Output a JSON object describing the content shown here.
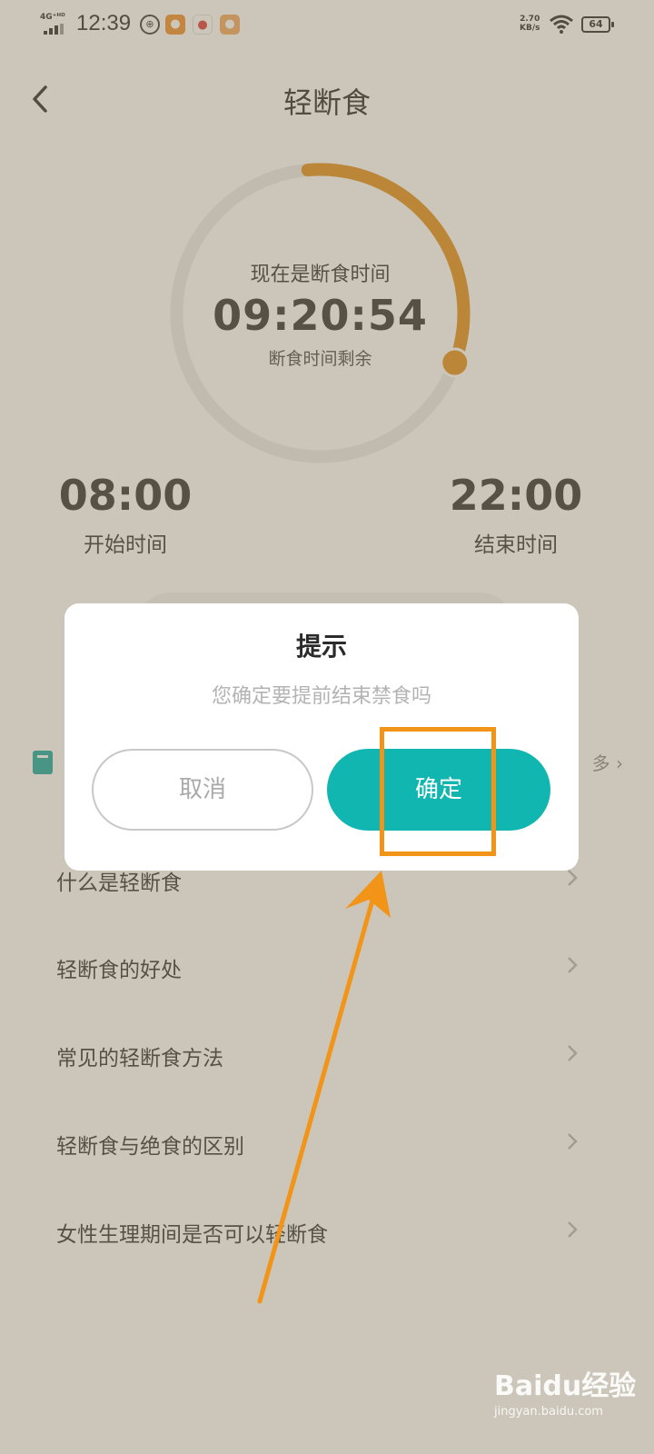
{
  "status_bar": {
    "network": "4G⁺ᴴᴰ",
    "time": "12:39",
    "speed_value": "2.70",
    "speed_unit": "KB/s",
    "battery": "64"
  },
  "header": {
    "title": "轻断食"
  },
  "timer": {
    "status": "现在是断食时间",
    "remaining": "09:20:54",
    "remaining_label": "断食时间剩余",
    "progress": 0.32
  },
  "schedule": {
    "start_time": "08:00",
    "start_label": "开始时间",
    "end_time": "22:00",
    "end_label": "结束时间"
  },
  "knowledge": {
    "more_partial": "多",
    "items": [
      {
        "label": "什么是轻断食"
      },
      {
        "label": "轻断食的好处"
      },
      {
        "label": "常见的轻断食方法"
      },
      {
        "label": "轻断食与绝食的区别"
      },
      {
        "label": "女性生理期间是否可以轻断食"
      }
    ]
  },
  "dialog": {
    "title": "提示",
    "message": "您确定要提前结束禁食吗",
    "cancel_label": "取消",
    "confirm_label": "确定"
  },
  "watermark": {
    "logo": "Baidu经验",
    "url": "jingyan.baidu.com"
  },
  "colors": {
    "accent_orange": "#e38a14",
    "teal": "#11b6b0",
    "annotation": "#f29418"
  }
}
